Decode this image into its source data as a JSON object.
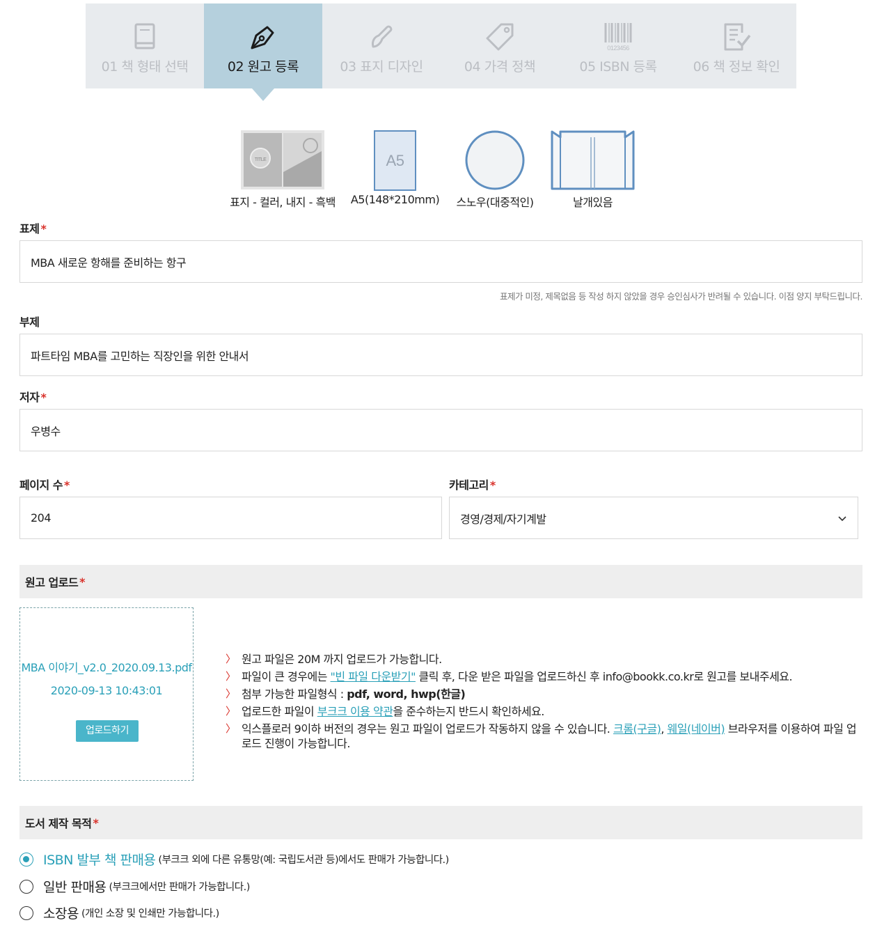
{
  "steps": [
    {
      "label": "01  책 형태 선택",
      "icon": "book-icon"
    },
    {
      "label": "02  원고 등록",
      "icon": "pen-nib-icon",
      "active": true
    },
    {
      "label": "03  표지 디자인",
      "icon": "brush-icon"
    },
    {
      "label": "04  가격 정책",
      "icon": "price-tag-icon"
    },
    {
      "label": "05  ISBN 등록",
      "icon": "barcode-icon",
      "barcode_digits": "0123456"
    },
    {
      "label": "06  책 정보 확인",
      "icon": "checklist-icon"
    }
  ],
  "book_options": {
    "color": "표지 - 컬러, 내지 - 흑백",
    "size": "A5(148*210mm)",
    "size_badge": "A5",
    "paper": "스노우(대중적인)",
    "wing": "날개있음",
    "cover_title": "TITLE"
  },
  "form": {
    "title_label": "표제",
    "title_value": "MBA 새로운 항해를 준비하는 항구",
    "title_hint": "표제가 미정, 제목없음 등 작성 하지 않았을 경우 승인심사가 반려될 수 있습니다. 이점 양지 부탁드립니다.",
    "subtitle_label": "부제",
    "subtitle_value": "파트타임 MBA를 고민하는 직장인을 위한 안내서",
    "author_label": "저자",
    "author_value": "우병수",
    "pages_label": "페이지 수",
    "pages_value": "204",
    "category_label": "카테고리",
    "category_value": "경영/경제/자기계발",
    "required_mark": "*"
  },
  "upload": {
    "section_title": "원고 업로드",
    "file_name": "MBA 이야기_v2.0_2020.09.13.pdf",
    "file_date": "2020-09-13 10:43:01",
    "button": "업로드하기",
    "notes": {
      "n1": "원고 파일은 20M 까지 업로드가 가능합니다.",
      "n2_a": "파일이 큰 경우에는 ",
      "n2_link": "\"빈 파일 다운받기\"",
      "n2_b": " 클릭 후, 다운 받은 파일을 업로드하신 후 info@bookk.co.kr로 원고를 보내주세요.",
      "n3_a": "첨부 가능한 파일형식 : ",
      "n3_b": "pdf, word, hwp(한글)",
      "n4_a": "업로드한 파일이 ",
      "n4_link": "부크크 이용 약관",
      "n4_b": "을 준수하는지 반드시 확인하세요.",
      "n5_a": "익스플로러 9이하 버전의 경우는 원고 파일이 업로드가 작동하지 않을 수 있습니다. ",
      "n5_link1": "크롬(구글)",
      "n5_sep": ", ",
      "n5_link2": "웨일(네이버)",
      "n5_b": " 브라우저를 이용하여 파일 업로드 진행이 가능합니다."
    }
  },
  "purpose": {
    "section_title": "도서 제작 목적",
    "options": [
      {
        "main": "ISBN 발부 책 판매용",
        "sub": "(부크크 외에 다른 유통망(예: 국립도서관 등)에서도 판매가 가능합니다.)",
        "selected": true
      },
      {
        "main": "일반 판매용",
        "sub": "(부크크에서만 판매가 가능합니다.)",
        "selected": false
      },
      {
        "main": "소장용",
        "sub": "(개인 소장 및 인쇄만 가능합니다.)",
        "selected": false
      }
    ]
  },
  "colors": {
    "accent": "#2aa0b8",
    "active_step": "#b5d0dd",
    "required": "#d9322b"
  }
}
